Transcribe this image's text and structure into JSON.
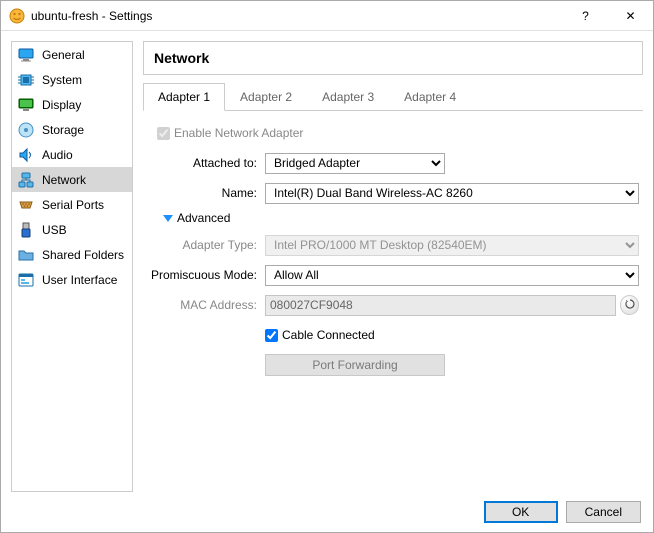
{
  "window": {
    "title": "ubuntu-fresh - Settings"
  },
  "sidebar": {
    "items": [
      {
        "label": "General"
      },
      {
        "label": "System"
      },
      {
        "label": "Display"
      },
      {
        "label": "Storage"
      },
      {
        "label": "Audio"
      },
      {
        "label": "Network"
      },
      {
        "label": "Serial Ports"
      },
      {
        "label": "USB"
      },
      {
        "label": "Shared Folders"
      },
      {
        "label": "User Interface"
      }
    ],
    "selected_index": 5
  },
  "main": {
    "title": "Network",
    "tabs": [
      {
        "label": "Adapter 1"
      },
      {
        "label": "Adapter 2"
      },
      {
        "label": "Adapter 3"
      },
      {
        "label": "Adapter 4"
      }
    ],
    "active_tab": 0,
    "enable_adapter": {
      "label": "Enable Network Adapter",
      "checked": true
    },
    "attached_to": {
      "label": "Attached to:",
      "value": "Bridged Adapter"
    },
    "name": {
      "label": "Name:",
      "value": "Intel(R) Dual Band Wireless-AC 8260"
    },
    "advanced_label": "Advanced",
    "adapter_type": {
      "label": "Adapter Type:",
      "value": "Intel PRO/1000 MT Desktop (82540EM)"
    },
    "promiscuous": {
      "label": "Promiscuous Mode:",
      "value": "Allow All"
    },
    "mac": {
      "label": "MAC Address:",
      "value": "080027CF9048"
    },
    "cable": {
      "label": "Cable Connected",
      "checked": true
    },
    "port_forwarding": "Port Forwarding"
  },
  "footer": {
    "ok": "OK",
    "cancel": "Cancel"
  }
}
